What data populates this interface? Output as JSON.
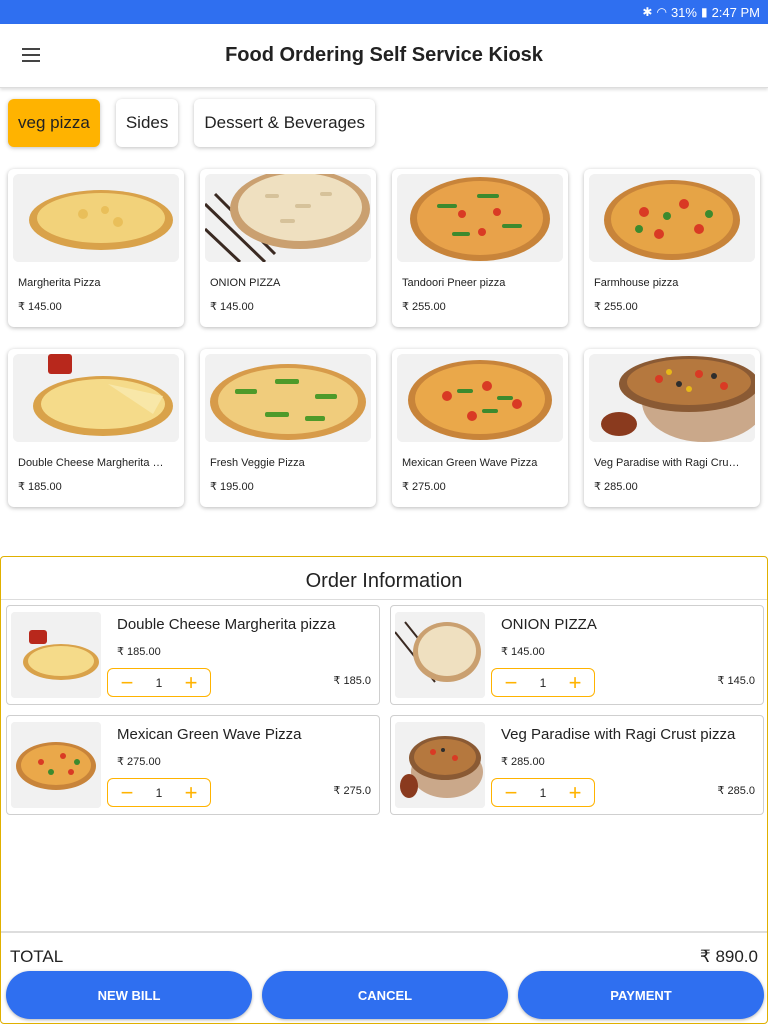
{
  "status": {
    "battery": "31%",
    "time": "2:47 PM"
  },
  "appbar": {
    "title": "Food Ordering Self Service Kiosk"
  },
  "categories": [
    "veg pizza",
    "Sides",
    "Dessert & Beverages"
  ],
  "menu": [
    {
      "name": "Margherita Pizza",
      "price": "₹ 145.00"
    },
    {
      "name": "ONION PIZZA",
      "price": "₹ 145.00"
    },
    {
      "name": "Tandoori Pneer pizza",
      "price": "₹ 255.00"
    },
    {
      "name": "Farmhouse pizza",
      "price": "₹ 255.00"
    },
    {
      "name": "Double Cheese  Margherita pizza",
      "price": "₹ 185.00"
    },
    {
      "name": "Fresh Veggie Pizza",
      "price": "₹ 195.00"
    },
    {
      "name": "Mexican Green Wave Pizza",
      "price": "₹ 275.00"
    },
    {
      "name": "Veg Paradise with Ragi Crust pizza",
      "price": "₹ 285.00"
    }
  ],
  "order": {
    "title": "Order Information",
    "items": [
      {
        "name": "Double Cheese  Margherita pizza",
        "price": "₹ 185.00",
        "qty": "1",
        "subtotal": "₹ 185.0"
      },
      {
        "name": "ONION PIZZA",
        "price": "₹ 145.00",
        "qty": "1",
        "subtotal": "₹ 145.0"
      },
      {
        "name": "Mexican Green Wave Pizza",
        "price": "₹ 275.00",
        "qty": "1",
        "subtotal": "₹ 275.0"
      },
      {
        "name": "Veg Paradise with Ragi Crust pizza",
        "price": "₹ 285.00",
        "qty": "1",
        "subtotal": "₹ 285.0"
      }
    ],
    "total_label": "TOTAL",
    "total_value": "₹ 890.0"
  },
  "actions": {
    "new_bill": "NEW BILL",
    "cancel": "CANCEL",
    "payment": "PAYMENT"
  },
  "icons": {
    "minus": "−",
    "plus": "+",
    "bluetooth": "bluetooth-icon",
    "wifi": "wifi-icon",
    "battery": "battery-icon"
  },
  "colors": {
    "primary": "#2f6ff0",
    "accent": "#ffb300"
  }
}
